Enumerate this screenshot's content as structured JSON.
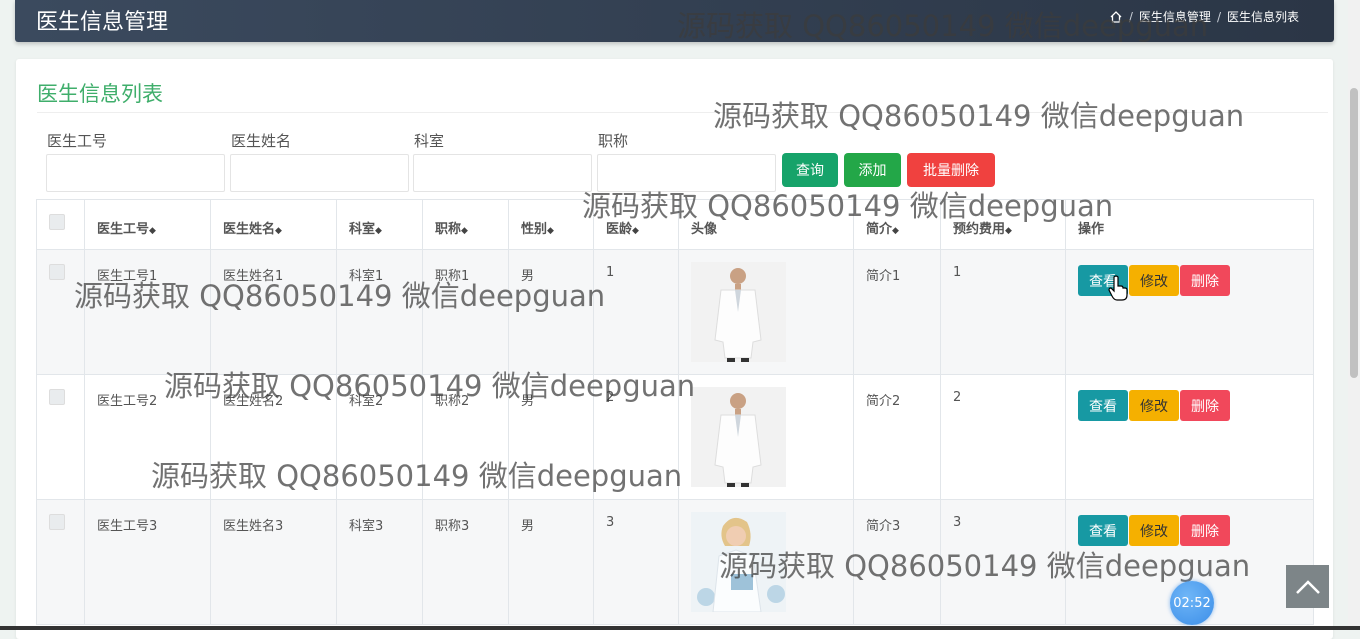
{
  "header": {
    "title": "医生信息管理",
    "breadcrumb": [
      "医生信息管理",
      "医生信息列表"
    ],
    "separator": "/"
  },
  "panel": {
    "title": "医生信息列表"
  },
  "filters": [
    {
      "label": "医生工号",
      "value": ""
    },
    {
      "label": "医生姓名",
      "value": ""
    },
    {
      "label": "科室",
      "value": ""
    },
    {
      "label": "职称",
      "value": ""
    }
  ],
  "buttons": {
    "query": "查询",
    "add": "添加",
    "batch_delete": "批量删除"
  },
  "table": {
    "columns": [
      "医生工号",
      "医生姓名",
      "科室",
      "职称",
      "性别",
      "医龄",
      "头像",
      "简介",
      "预约费用",
      "操作"
    ],
    "sortable": [
      true,
      true,
      true,
      true,
      true,
      true,
      false,
      true,
      true,
      false
    ],
    "sort_icon": "sort-icon",
    "rows": [
      {
        "id": "医生工号1",
        "name": "医生姓名1",
        "dept": "科室1",
        "title": "职称1",
        "gender": "男",
        "years": "1",
        "avatar": "doctor-male-photo",
        "intro": "简介1",
        "fee": "1"
      },
      {
        "id": "医生工号2",
        "name": "医生姓名2",
        "dept": "科室2",
        "title": "职称2",
        "gender": "男",
        "years": "2",
        "avatar": "doctor-male-photo",
        "intro": "简介2",
        "fee": "2"
      },
      {
        "id": "医生工号3",
        "name": "医生姓名3",
        "dept": "科室3",
        "title": "职称3",
        "gender": "男",
        "years": "3",
        "avatar": "doctor-female-photo",
        "intro": "简介3",
        "fee": "3"
      }
    ],
    "actions": {
      "view": "查看",
      "edit": "修改",
      "delete": "删除"
    }
  },
  "watermark": "源码获取 QQ86050149 微信deepguan",
  "timer": "02:52",
  "colors": {
    "title_green": "#3fae6b",
    "query": "#16a36a",
    "add": "#23a748",
    "batch_delete": "#f0413f",
    "view": "#1799a3",
    "edit": "#f5b000",
    "delete": "#f1485b"
  }
}
